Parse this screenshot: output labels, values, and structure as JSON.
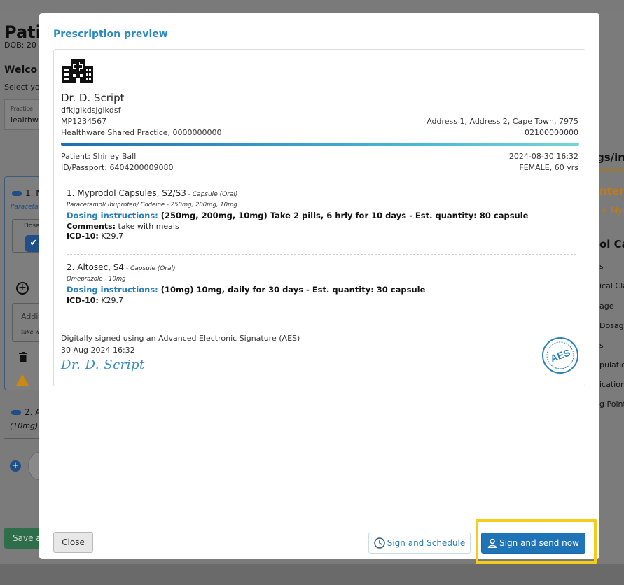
{
  "background": {
    "title": "Pati",
    "dob": "DOB: 20 /",
    "welcome": "Welco",
    "select_text": "Select yo",
    "practice_label": "Practice",
    "practice_value": "lealthwa",
    "med1_label": "1. M",
    "med1_sub": "Paracetar",
    "dosage_label": "Dosa",
    "additional_label": "Additi",
    "additional_sub": "take wit",
    "med2_label": "2. A",
    "med2_sub": "(10mg) 1",
    "save_label": "Save as",
    "right_title": "gs/in",
    "right_interactions": "nter",
    "right_myp": "+ Myp",
    "right_section": "ol Ca",
    "right_items": [
      "s",
      "ical Cla",
      "age",
      "Dosag",
      "s",
      "pulation",
      "ication",
      "g Point"
    ]
  },
  "modal": {
    "title": "Prescription preview",
    "doctor": {
      "name": "Dr. D. Script",
      "line1": "dfkjglkdsjglkdsf",
      "registration": "MP1234567",
      "practice": "Healthware Shared Practice, 0000000000",
      "address": "Address 1, Address 2, Cape Town, 7975",
      "phone": "02100000000"
    },
    "patient": {
      "name_line": "Patient: Shirley Ball",
      "id_line": "ID/Passport: 6404200009080",
      "datetime": "2024-08-30 16:32",
      "gender_age": "FEMALE, 60 yrs"
    },
    "items": [
      {
        "title": "1. Myprodol Capsules, S2/S3",
        "form": " - Capsule (Oral)",
        "ingredients": "Paracetamol/ Ibuprofen/ Codeine - 250mg, 200mg, 10mg",
        "dosing_label": "Dosing instructions:",
        "dosing_text": " (250mg, 200mg, 10mg) Take 2 pills, 6 hrly for 10 days - Est. quantity: 80 capsule",
        "comments_label": "Comments:",
        "comments_text": " take with meals",
        "icd_label": "ICD-10:",
        "icd_text": " K29.7"
      },
      {
        "title": "2. Altosec, S4",
        "form": " - Capsule (Oral)",
        "ingredients": "Omeprazole - 10mg",
        "dosing_label": "Dosing instructions:",
        "dosing_text": " (10mg) 10mg, daily for 30 days - Est. quantity: 30 capsule",
        "icd_label": "ICD-10:",
        "icd_text": " K29.7"
      }
    ],
    "signature": {
      "statement": "Digitally signed using an Advanced Electronic Signature (AES)",
      "date": "30 Aug 2024 16:32",
      "script": "Dr. D. Script",
      "badge": "AES"
    },
    "buttons": {
      "close": "Close",
      "schedule": "Sign and Schedule",
      "send": "Sign and send now"
    }
  },
  "colors": {
    "accent": "#2b8bc0",
    "primary_button": "#1f74b8",
    "highlight": "#f5cc1b",
    "warning": "#c88a12"
  },
  "icons": {
    "hospital": "hospital-icon",
    "clock": "clock-icon",
    "user": "user-icon",
    "aes_seal": "aes-seal-icon"
  }
}
